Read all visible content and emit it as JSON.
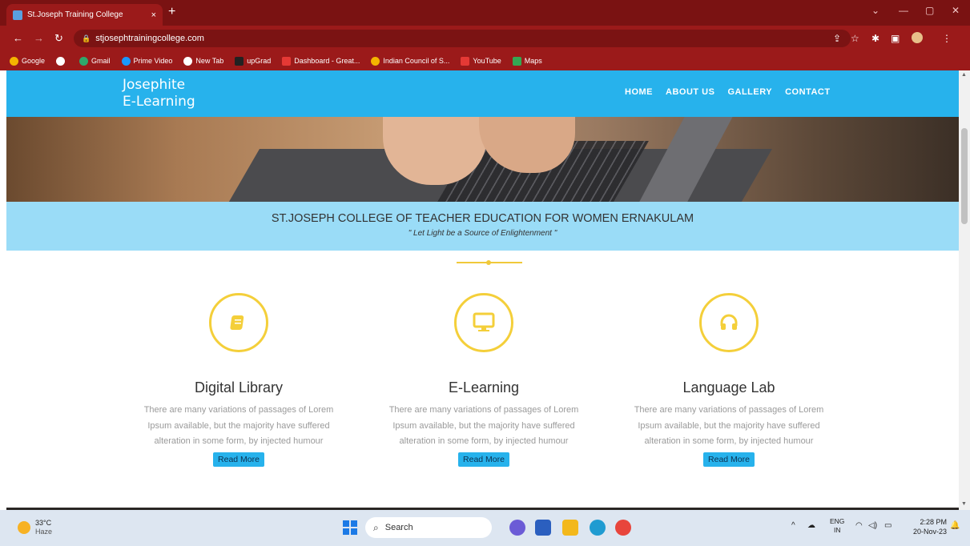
{
  "browser": {
    "tab_title": "St.Joseph Training College",
    "tab_close": "×",
    "new_tab": "+",
    "url": "stjosephtrainingcollege.com",
    "window_controls": [
      "⌄",
      "—",
      "▢",
      "✕"
    ],
    "bookmarks": [
      {
        "label": "Google",
        "color": "#f4b400"
      },
      {
        "label": "",
        "color": "#ffffff"
      },
      {
        "label": "Gmail",
        "color": "#2fa86b"
      },
      {
        "label": "Prime Video",
        "color": "#1a98ff"
      },
      {
        "label": "New Tab",
        "color": "#ffffff"
      },
      {
        "label": "upGrad",
        "color": "#222222"
      },
      {
        "label": "Dashboard - Great...",
        "color": "#e53935"
      },
      {
        "label": "Indian Council of S...",
        "color": "#f4b400"
      },
      {
        "label": "YouTube",
        "color": "#e53935"
      },
      {
        "label": "Maps",
        "color": "#34a853"
      }
    ]
  },
  "site": {
    "logo_line1": "Josephite",
    "logo_line2": "E-Learning",
    "nav": [
      "HOME",
      "ABOUT US",
      "GALLERY",
      "CONTACT"
    ],
    "banner_title": "ST.JOSEPH COLLEGE OF TEACHER EDUCATION FOR WOMEN ERNAKULAM",
    "banner_motto": "\" Let Light be a Source of Enlightenment \"",
    "features": [
      {
        "title": "Digital Library",
        "icon": "book-icon",
        "desc": "There are many variations of passages of Lorem Ipsum available, but the majority have suffered alteration in some form, by injected humour",
        "button": "Read More"
      },
      {
        "title": "E-Learning",
        "icon": "monitor-icon",
        "desc": "There are many variations of passages of Lorem Ipsum available, but the majority have suffered alteration in some form, by injected humour",
        "button": "Read More"
      },
      {
        "title": "Language Lab",
        "icon": "headphones-icon",
        "desc": "There are many variations of passages of Lorem Ipsum available, but the majority have suffered alteration in some form, by injected humour",
        "button": "Read More"
      }
    ]
  },
  "taskbar": {
    "temp": "33°C",
    "condition": "Haze",
    "search_placeholder": "Search",
    "lang_top": "ENG",
    "lang_bottom": "IN",
    "time": "2:28 PM",
    "date": "20-Nov-23"
  },
  "colors": {
    "header": "#27b2ec",
    "banner": "#9adcf7",
    "accent": "#f4cf3a",
    "chrome": "#9b1a1a"
  }
}
